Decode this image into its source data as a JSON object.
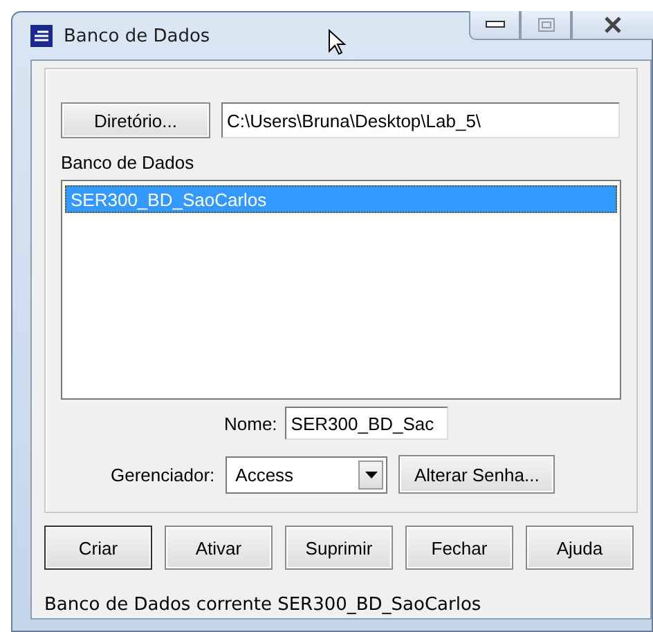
{
  "window": {
    "title": "Banco de Dados"
  },
  "directory": {
    "button": "Diretório...",
    "path": "C:\\Users\\Bruna\\Desktop\\Lab_5\\"
  },
  "database_list": {
    "label": "Banco de Dados",
    "items": [
      {
        "text": "SER300_BD_SaoCarlos",
        "selected": true
      }
    ]
  },
  "name_field": {
    "label": "Nome:",
    "value": "SER300_BD_Sac"
  },
  "manager": {
    "label": "Gerenciador:",
    "value": "Access",
    "button": "Alterar Senha..."
  },
  "buttons": [
    {
      "label": "Criar",
      "selected": true
    },
    {
      "label": "Ativar",
      "selected": false
    },
    {
      "label": "Suprimir",
      "selected": false
    },
    {
      "label": "Fechar",
      "selected": false
    },
    {
      "label": "Ajuda",
      "selected": false
    }
  ],
  "status_bar": "Banco de Dados corrente SER300_BD_SaoCarlos"
}
